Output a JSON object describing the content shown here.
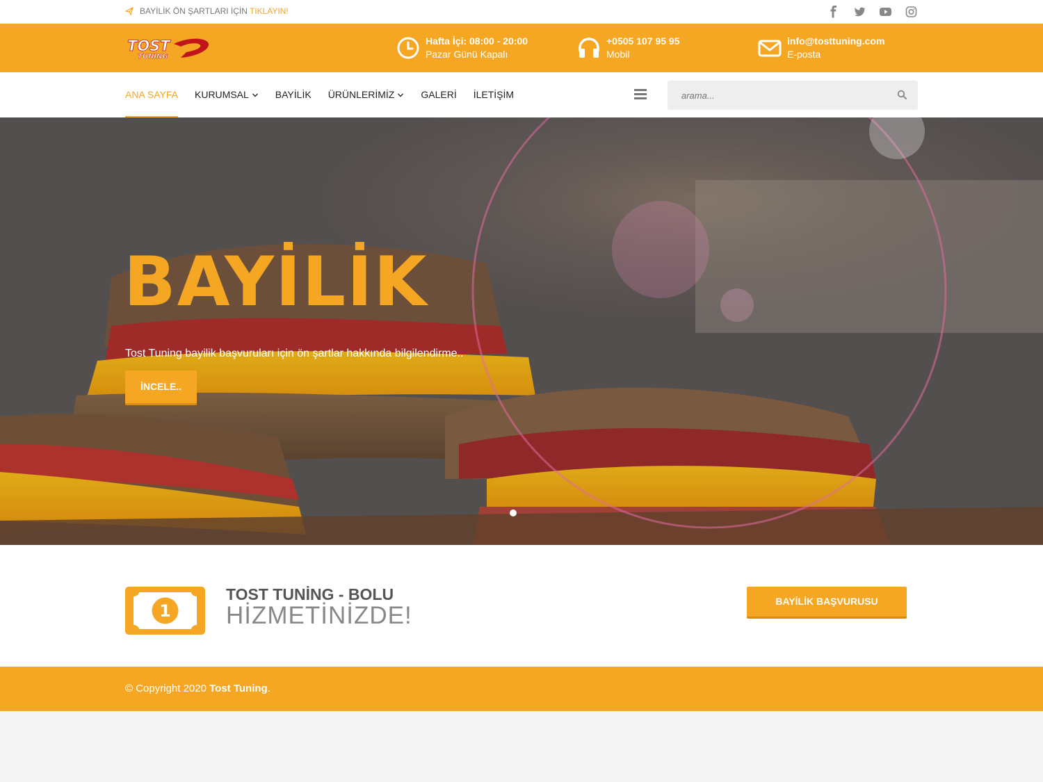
{
  "topbar": {
    "notice_text": "BAYİLİK ÖN ŞARTLARI İÇİN",
    "notice_link": "TIKLAYIN!",
    "social": [
      "facebook-icon",
      "twitter-icon",
      "youtube-icon",
      "instagram-icon"
    ]
  },
  "header": {
    "logo_text": "TOST TUNING",
    "hours": {
      "line1": "Hafta İçi: 08:00 - 20:00",
      "line2": "Pazar Günü Kapalı"
    },
    "phone": {
      "line1": "+0505 107 95 95",
      "line2": "Mobil"
    },
    "email": {
      "line1": "info@tosttuning.com",
      "line2": "E-posta"
    }
  },
  "nav": {
    "items": [
      {
        "label": "ANA SAYFA",
        "active": true
      },
      {
        "label": "KURUMSAL",
        "dropdown": true
      },
      {
        "label": "BAYİLİK"
      },
      {
        "label": "ÜRÜNLERİMİZ",
        "dropdown": true
      },
      {
        "label": "GALERİ"
      },
      {
        "label": "İLETİŞİM"
      }
    ],
    "search_placeholder": "arama..."
  },
  "hero": {
    "title": "BAYİLİK",
    "subtitle": "Tost Tuning bayilik başvuruları için ön şartlar hakkında bilgilendirme..",
    "button": "İNCELE..",
    "slides": 1
  },
  "promo": {
    "line1": "TOST TUNİNG - BOLU",
    "line2": "HİZMETİNİZDE!",
    "button": "BAYİLİK BAŞVURUSU"
  },
  "footer": {
    "copyright": "© Copyright 2020",
    "brand": "Tost Tuning",
    "suffix": "."
  },
  "colors": {
    "accent": "#f5a623",
    "accent_dark": "#d98c10",
    "text": "#222222"
  }
}
